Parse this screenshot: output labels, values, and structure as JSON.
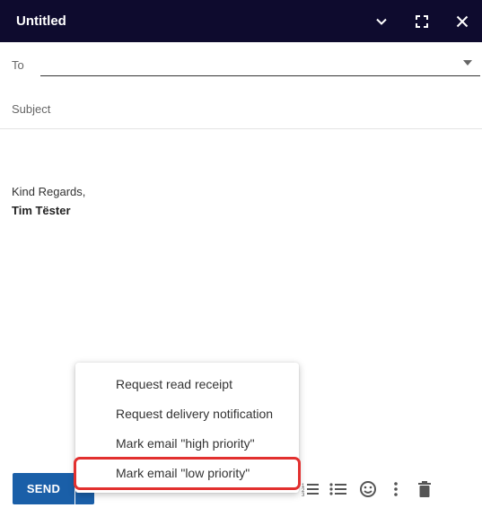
{
  "window": {
    "title": "Untitled",
    "controls": [
      "chevron-down-icon",
      "fullscreen-icon",
      "close-icon"
    ]
  },
  "compose": {
    "to_label": "To",
    "to_value": "",
    "subject_placeholder": "Subject",
    "subject_value": ""
  },
  "body": {
    "closing": "Kind Regards,",
    "signature_name": "Tim Tëster"
  },
  "toolbar": {
    "send_label": "SEND",
    "icons": [
      "numbered-list-icon",
      "bulleted-list-icon",
      "emoji-icon",
      "more-options-icon",
      "trash-icon"
    ]
  },
  "options_menu": {
    "items": [
      {
        "label": "Request read receipt"
      },
      {
        "label": "Request delivery notification"
      },
      {
        "label": "Mark email \"high priority\""
      },
      {
        "label": "Mark email \"low priority\"",
        "highlighted": true
      }
    ]
  },
  "colors": {
    "titlebar": "#0e0b2e",
    "send_button": "#1a5fa8",
    "highlight_outline": "#e2302f"
  }
}
